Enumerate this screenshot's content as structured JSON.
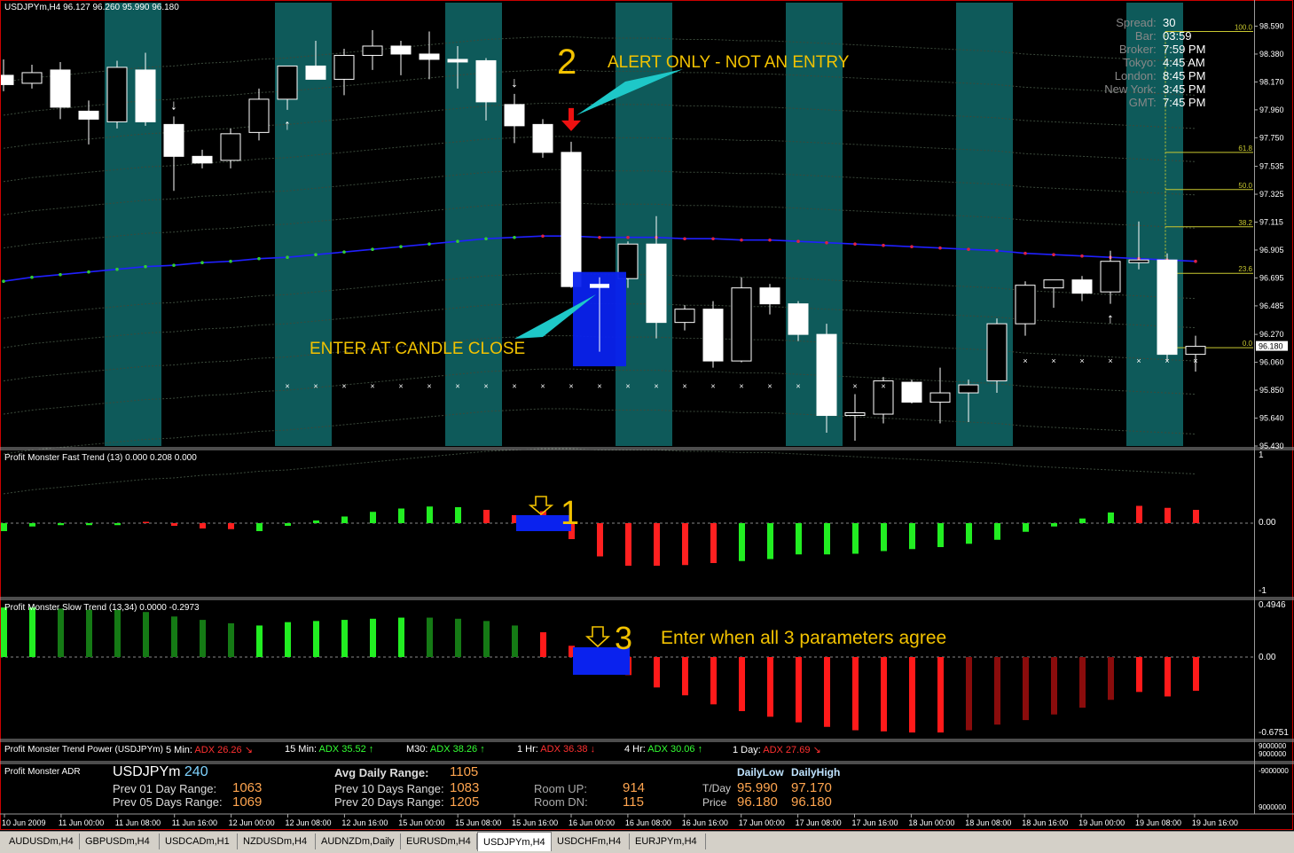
{
  "symbol_header": "USDJPYm,H4  96.127 96.260 95.990 96.180",
  "price_axis": [
    "98.590",
    "98.380",
    "98.170",
    "97.960",
    "97.750",
    "97.535",
    "97.325",
    "97.115",
    "96.905",
    "96.695",
    "96.485",
    "96.270",
    "96.060",
    "95.850",
    "95.640",
    "95.430"
  ],
  "current_price_tag": "96.180",
  "fib_levels": [
    {
      "label": "100.0",
      "price": 98.55
    },
    {
      "label": "61.8",
      "price": 97.64
    },
    {
      "label": "50.0",
      "price": 97.36
    },
    {
      "label": "38.2",
      "price": 97.08
    },
    {
      "label": "23.6",
      "price": 96.73
    },
    {
      "label": "0.0",
      "price": 96.17
    }
  ],
  "info_panel": {
    "rows": [
      {
        "label": "Spread:",
        "value": "30"
      },
      {
        "label": "Bar:",
        "value": "03:59"
      },
      {
        "label": "Broker:",
        "value": "7:59 PM"
      },
      {
        "label": "Tokyo:",
        "value": "4:45 AM"
      },
      {
        "label": "London:",
        "value": "8:45 PM"
      },
      {
        "label": "New York:",
        "value": "3:45 PM"
      },
      {
        "label": "GMT:",
        "value": "7:45 PM"
      }
    ]
  },
  "annotations": {
    "step2_number": "2",
    "alert_text": "ALERT ONLY - NOT AN ENTRY",
    "enter_text": "ENTER AT CANDLE CLOSE",
    "step1_number": "1",
    "step3_number": "3",
    "step3_text": "Enter when all 3 parameters agree"
  },
  "fast_trend": {
    "title": "Profit Monster Fast Trend (13) 0.000 0.208 0.000",
    "axis": [
      "1",
      "0.00",
      "-1"
    ]
  },
  "slow_trend": {
    "title": "Profit Monster Slow Trend (13,34) 0.0000 -0.2973",
    "axis": [
      "0.4946",
      "0.00",
      "-0.6751"
    ]
  },
  "trend_power": {
    "title": "Profit Monster Trend Power (USDJPYm)",
    "items": [
      {
        "tf": "5 Min:",
        "adx": "ADX 26.26",
        "dir": "down",
        "color": "#ff3030"
      },
      {
        "tf": "15 Min:",
        "adx": "ADX 35.52",
        "dir": "up",
        "color": "#33ff33"
      },
      {
        "tf": "M30:",
        "adx": "ADX 38.26",
        "dir": "up",
        "color": "#33ff33"
      },
      {
        "tf": "1 Hr:",
        "adx": "ADX 36.38",
        "dir": "down",
        "color": "#ff3030"
      },
      {
        "tf": "4 Hr:",
        "adx": "ADX 30.06",
        "dir": "up",
        "color": "#33ff33"
      },
      {
        "tf": "1 Day:",
        "adx": "ADX 27.69",
        "dir": "down",
        "color": "#ff3030"
      }
    ],
    "axis": [
      "9000000",
      "9000000"
    ]
  },
  "adr": {
    "title": "Profit Monster ADR",
    "symbol": "USDJPYm",
    "period": "240",
    "avg_label": "Avg Daily Range:",
    "avg_value": "1105",
    "prev01_label": "Prev 01 Day Range:",
    "prev01_value": "1063",
    "prev05_label": "Prev 05 Days Range:",
    "prev05_value": "1069",
    "prev10_label": "Prev 10 Days Range:",
    "prev10_value": "1083",
    "prev20_label": "Prev 20 Days Range:",
    "prev20_value": "1205",
    "room_up_label": "Room UP:",
    "room_up_value": "914",
    "room_dn_label": "Room DN:",
    "room_dn_value": "115",
    "daily_low_hdr": "DailyLow",
    "daily_high_hdr": "DailyHigh",
    "tday_label": "T/Day",
    "tday_low": "95.990",
    "tday_high": "97.170",
    "price_label": "Price",
    "price_low": "96.180",
    "price_high": "96.180",
    "axis": [
      "-9000000",
      "9000000"
    ]
  },
  "time_axis": [
    "10 Jun 2009",
    "11 Jun 00:00",
    "11 Jun 08:00",
    "11 Jun 16:00",
    "12 Jun 00:00",
    "12 Jun 08:00",
    "12 Jun 16:00",
    "15 Jun 00:00",
    "15 Jun 08:00",
    "15 Jun 16:00",
    "16 Jun 00:00",
    "16 Jun 08:00",
    "16 Jun 16:00",
    "17 Jun 00:00",
    "17 Jun 08:00",
    "17 Jun 16:00",
    "18 Jun 00:00",
    "18 Jun 08:00",
    "18 Jun 16:00",
    "19 Jun 00:00",
    "19 Jun 08:00",
    "19 Jun 16:00"
  ],
  "tabs": [
    {
      "label": "AUDUSDm,H4",
      "active": false
    },
    {
      "label": "GBPUSDm,H4",
      "active": false
    },
    {
      "label": "USDCADm,H1",
      "active": false
    },
    {
      "label": "NZDUSDm,H4",
      "active": false
    },
    {
      "label": "AUDNZDm,Daily",
      "active": false
    },
    {
      "label": "EURUSDm,H4",
      "active": false
    },
    {
      "label": "USDJPYm,H4",
      "active": true
    },
    {
      "label": "USDCHFm,H4",
      "active": false
    },
    {
      "label": "EURJPYm,H4",
      "active": false
    }
  ],
  "colors": {
    "session_band": "#0e5a5a",
    "bull_candle": "#000000",
    "bear_candle": "#ffffff",
    "ma_line": "#2020ff",
    "hist_up": "#22ee22",
    "hist_down": "#ff2020",
    "highlight": "#0a22ee",
    "annotation": "#f2c200",
    "border": "#cc0000"
  },
  "chart_data": {
    "type": "candlestick",
    "timeframe": "H4",
    "ylim": [
      95.43,
      98.7
    ],
    "candles": [
      {
        "o": 98.22,
        "h": 98.34,
        "l": 98.1,
        "c": 98.15
      },
      {
        "o": 98.16,
        "h": 98.3,
        "l": 98.12,
        "c": 98.24
      },
      {
        "o": 98.26,
        "h": 98.32,
        "l": 97.89,
        "c": 97.98
      },
      {
        "o": 97.95,
        "h": 98.03,
        "l": 97.7,
        "c": 97.89
      },
      {
        "o": 97.87,
        "h": 98.33,
        "l": 97.82,
        "c": 98.28
      },
      {
        "o": 98.26,
        "h": 98.39,
        "l": 97.84,
        "c": 97.87
      },
      {
        "o": 97.85,
        "h": 97.91,
        "l": 97.35,
        "c": 97.61
      },
      {
        "o": 97.61,
        "h": 97.66,
        "l": 97.52,
        "c": 97.56
      },
      {
        "o": 97.58,
        "h": 97.82,
        "l": 97.52,
        "c": 97.78
      },
      {
        "o": 97.79,
        "h": 98.12,
        "l": 97.73,
        "c": 98.04
      },
      {
        "o": 98.04,
        "h": 98.24,
        "l": 97.96,
        "c": 98.29
      },
      {
        "o": 98.29,
        "h": 98.48,
        "l": 98.24,
        "c": 98.19
      },
      {
        "o": 98.19,
        "h": 98.42,
        "l": 98.07,
        "c": 98.37
      },
      {
        "o": 98.37,
        "h": 98.56,
        "l": 98.26,
        "c": 98.44
      },
      {
        "o": 98.44,
        "h": 98.48,
        "l": 98.22,
        "c": 98.38
      },
      {
        "o": 98.38,
        "h": 98.55,
        "l": 98.19,
        "c": 98.34
      },
      {
        "o": 98.34,
        "h": 98.44,
        "l": 98.12,
        "c": 98.32
      },
      {
        "o": 98.33,
        "h": 98.35,
        "l": 97.88,
        "c": 98.02
      },
      {
        "o": 98.0,
        "h": 98.08,
        "l": 97.71,
        "c": 97.84
      },
      {
        "o": 97.85,
        "h": 97.89,
        "l": 97.6,
        "c": 97.64
      },
      {
        "o": 97.64,
        "h": 97.72,
        "l": 96.62,
        "c": 96.63
      },
      {
        "o": 96.65,
        "h": 96.7,
        "l": 96.14,
        "c": 96.62
      },
      {
        "o": 96.69,
        "h": 96.97,
        "l": 96.62,
        "c": 96.95
      },
      {
        "o": 96.95,
        "h": 97.16,
        "l": 96.24,
        "c": 96.36
      },
      {
        "o": 96.36,
        "h": 96.49,
        "l": 96.3,
        "c": 96.46
      },
      {
        "o": 96.46,
        "h": 96.52,
        "l": 96.02,
        "c": 96.07
      },
      {
        "o": 96.07,
        "h": 96.7,
        "l": 96.06,
        "c": 96.62
      },
      {
        "o": 96.62,
        "h": 96.65,
        "l": 96.42,
        "c": 96.5
      },
      {
        "o": 96.5,
        "h": 96.52,
        "l": 96.22,
        "c": 96.27
      },
      {
        "o": 96.27,
        "h": 96.35,
        "l": 95.53,
        "c": 95.66
      },
      {
        "o": 95.66,
        "h": 95.82,
        "l": 95.47,
        "c": 95.68
      },
      {
        "o": 95.67,
        "h": 95.95,
        "l": 95.6,
        "c": 95.92
      },
      {
        "o": 95.91,
        "h": 95.93,
        "l": 95.75,
        "c": 95.76
      },
      {
        "o": 95.76,
        "h": 96.02,
        "l": 95.6,
        "c": 95.83
      },
      {
        "o": 95.83,
        "h": 95.93,
        "l": 95.61,
        "c": 95.89
      },
      {
        "o": 95.92,
        "h": 96.39,
        "l": 95.83,
        "c": 96.35
      },
      {
        "o": 96.35,
        "h": 96.67,
        "l": 96.26,
        "c": 96.64
      },
      {
        "o": 96.62,
        "h": 96.65,
        "l": 96.47,
        "c": 96.68
      },
      {
        "o": 96.68,
        "h": 96.71,
        "l": 96.52,
        "c": 96.58
      },
      {
        "o": 96.59,
        "h": 96.9,
        "l": 96.5,
        "c": 96.82
      },
      {
        "o": 96.81,
        "h": 97.12,
        "l": 96.76,
        "c": 96.83
      },
      {
        "o": 96.83,
        "h": 96.88,
        "l": 96.07,
        "c": 96.12
      },
      {
        "o": 96.12,
        "h": 96.26,
        "l": 95.99,
        "c": 96.18
      }
    ],
    "ma": [
      96.67,
      96.7,
      96.72,
      96.74,
      96.76,
      96.78,
      96.79,
      96.81,
      96.82,
      96.84,
      96.85,
      96.87,
      96.89,
      96.91,
      96.93,
      96.95,
      96.97,
      96.99,
      97.0,
      97.01,
      97.01,
      97.0,
      97.0,
      97.0,
      96.99,
      96.99,
      96.98,
      96.98,
      96.97,
      96.96,
      96.95,
      96.94,
      96.93,
      96.92,
      96.91,
      96.9,
      96.88,
      96.87,
      96.86,
      96.85,
      96.84,
      96.83,
      96.82
    ],
    "up_arrows_idx": [
      10,
      39
    ],
    "down_arrows_idx": [
      6,
      18
    ],
    "signal_idx": 20,
    "stop_dots_from": 10,
    "stop_dots_to": 31,
    "stop_dots_price": 95.88,
    "stop_dots2_from": 36,
    "stop_dots2_to": 42,
    "stop_dots2_price": 96.07,
    "session_band_idx": [
      [
        4,
        5
      ],
      [
        10,
        11
      ],
      [
        16,
        17
      ],
      [
        22,
        23
      ],
      [
        28,
        29
      ],
      [
        34,
        35
      ],
      [
        40,
        41
      ]
    ],
    "fast_trend_values": [
      -0.12,
      -0.05,
      -0.03,
      -0.03,
      -0.03,
      0.02,
      -0.04,
      -0.08,
      -0.09,
      -0.12,
      -0.04,
      0.04,
      0.1,
      0.17,
      0.22,
      0.25,
      0.24,
      0.2,
      0.12,
      0.18,
      -0.24,
      -0.5,
      -0.64,
      -0.64,
      -0.63,
      -0.6,
      -0.57,
      -0.54,
      -0.47,
      -0.47,
      -0.46,
      -0.42,
      -0.39,
      -0.36,
      -0.31,
      -0.25,
      -0.13,
      -0.05,
      0.07,
      0.16,
      0.26,
      0.23,
      0.2
    ],
    "fast_trend_colors": [
      "g",
      "g",
      "g",
      "g",
      "g",
      "r",
      "r",
      "r",
      "r",
      "g",
      "g",
      "g",
      "g",
      "g",
      "g",
      "g",
      "g",
      "r",
      "r",
      "r",
      "r",
      "r",
      "r",
      "r",
      "r",
      "r",
      "g",
      "g",
      "g",
      "g",
      "g",
      "g",
      "g",
      "g",
      "g",
      "g",
      "g",
      "g",
      "g",
      "g",
      "r",
      "r",
      "r"
    ],
    "slow_trend_values": [
      0.44,
      0.44,
      0.43,
      0.42,
      0.42,
      0.4,
      0.36,
      0.33,
      0.3,
      0.28,
      0.31,
      0.32,
      0.33,
      0.34,
      0.35,
      0.35,
      0.34,
      0.32,
      0.28,
      0.22,
      0.1,
      -0.05,
      -0.16,
      -0.27,
      -0.34,
      -0.42,
      -0.48,
      -0.53,
      -0.58,
      -0.62,
      -0.65,
      -0.66,
      -0.67,
      -0.67,
      -0.65,
      -0.6,
      -0.56,
      -0.51,
      -0.45,
      -0.38,
      -0.31,
      -0.35,
      -0.3
    ],
    "slow_trend_colors": [
      "g",
      "g",
      "dg",
      "dg",
      "dg",
      "dg",
      "dg",
      "dg",
      "dg",
      "g",
      "g",
      "g",
      "g",
      "g",
      "g",
      "dg",
      "dg",
      "dg",
      "dg",
      "r",
      "r",
      "r",
      "r",
      "r",
      "r",
      "r",
      "r",
      "r",
      "r",
      "r",
      "r",
      "r",
      "r",
      "r",
      "dr",
      "dr",
      "dr",
      "dr",
      "dr",
      "dr",
      "r",
      "r",
      "r"
    ]
  }
}
